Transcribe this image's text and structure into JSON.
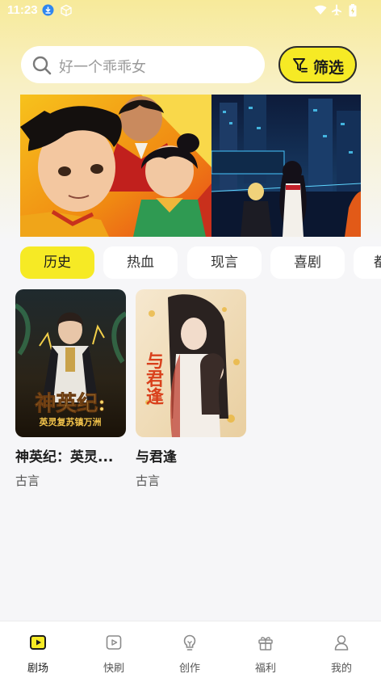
{
  "status_bar": {
    "time": "11:23"
  },
  "search": {
    "placeholder": "好一个乖乖女"
  },
  "filter": {
    "label": "筛选"
  },
  "genre_tabs": [
    {
      "label": "历史",
      "active": true
    },
    {
      "label": "热血",
      "active": false
    },
    {
      "label": "现言",
      "active": false
    },
    {
      "label": "喜剧",
      "active": false
    },
    {
      "label": "都",
      "active": false
    }
  ],
  "dramas": [
    {
      "title": "神英纪：英灵...",
      "tag": "古言",
      "cover_title": "神英纪:",
      "cover_subtitle": "英灵复苏镇万洲"
    },
    {
      "title": "与君逢",
      "tag": "古言",
      "cover_title": "与君逢"
    }
  ],
  "bottom_nav": [
    {
      "label": "剧场",
      "icon": "theater-icon",
      "active": true
    },
    {
      "label": "快刷",
      "icon": "play-icon",
      "active": false
    },
    {
      "label": "创作",
      "icon": "bulb-icon",
      "active": false
    },
    {
      "label": "福利",
      "icon": "gift-icon",
      "active": false
    },
    {
      "label": "我的",
      "icon": "person-icon",
      "active": false
    }
  ],
  "colors": {
    "accent": "#f6ea25",
    "background": "#f6f6f8"
  }
}
